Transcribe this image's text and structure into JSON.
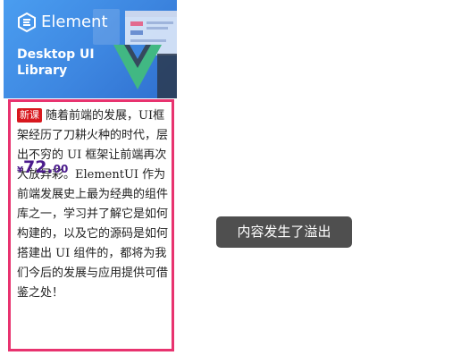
{
  "banner": {
    "brand": "Element",
    "title_line1": "Desktop UI",
    "title_line2": "Library",
    "bg_color": "#3d86e0",
    "logo_icon": "element-logo-icon",
    "vue_icon": "vue-logo-icon"
  },
  "course": {
    "badge": "新课",
    "description": "随着前端的发展，UI框架经历了刀耕火种的时代，层出不穷的 UI 框架让前端再次大放异彩。ElementUI 作为前端发展史上最为经典的组件库之一，学习并了解它是如何构建的，以及它的源码是如何搭建出 UI 组件的，都将为我们今后的发展与应用提供可借鉴之处！",
    "price_currency": "¥",
    "price_integer": "72.",
    "price_decimal": "00",
    "badge_color": "#d8181e",
    "border_color": "#e8336f",
    "price_color": "#4b1b8c"
  },
  "toast": {
    "message": "内容发生了溢出"
  }
}
